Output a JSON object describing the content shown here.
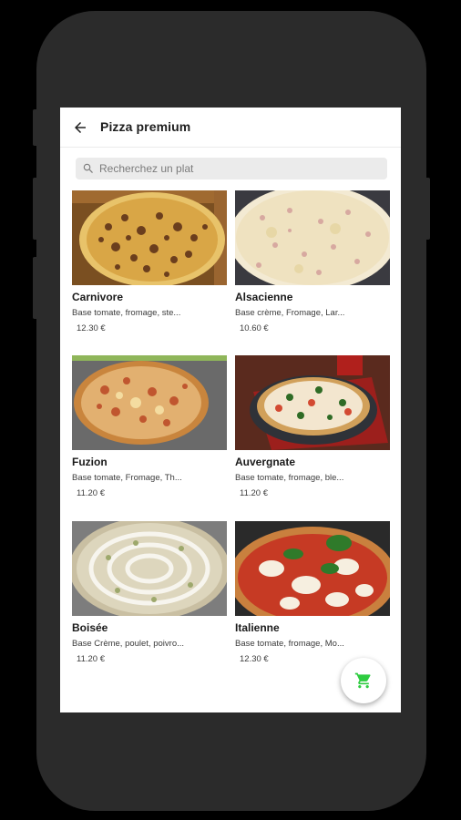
{
  "header": {
    "title": "Pizza premium"
  },
  "search": {
    "placeholder": "Recherchez un plat"
  },
  "products": [
    {
      "name": "Carnivore",
      "description": "Base tomate, fromage, ste...",
      "price": "12.30 €"
    },
    {
      "name": "Alsacienne",
      "description": "Base crème, Fromage, Lar...",
      "price": "10.60 €"
    },
    {
      "name": "Fuzion",
      "description": "Base tomate, Fromage, Th...",
      "price": "11.20 €"
    },
    {
      "name": "Auvergnate",
      "description": "Base tomate, fromage, ble...",
      "price": "11.20 €"
    },
    {
      "name": "Boisée",
      "description": "Base Crème, poulet, poivro...",
      "price": "11.20 €"
    },
    {
      "name": "Italienne",
      "description": "Base tomate, fromage, Mo...",
      "price": "12.30 €"
    }
  ],
  "colors": {
    "accent": "#2ecc40",
    "phone_body": "#2b2b2b"
  },
  "icons": {
    "back": "arrow-left",
    "search": "magnifier",
    "cart": "shopping-cart"
  }
}
